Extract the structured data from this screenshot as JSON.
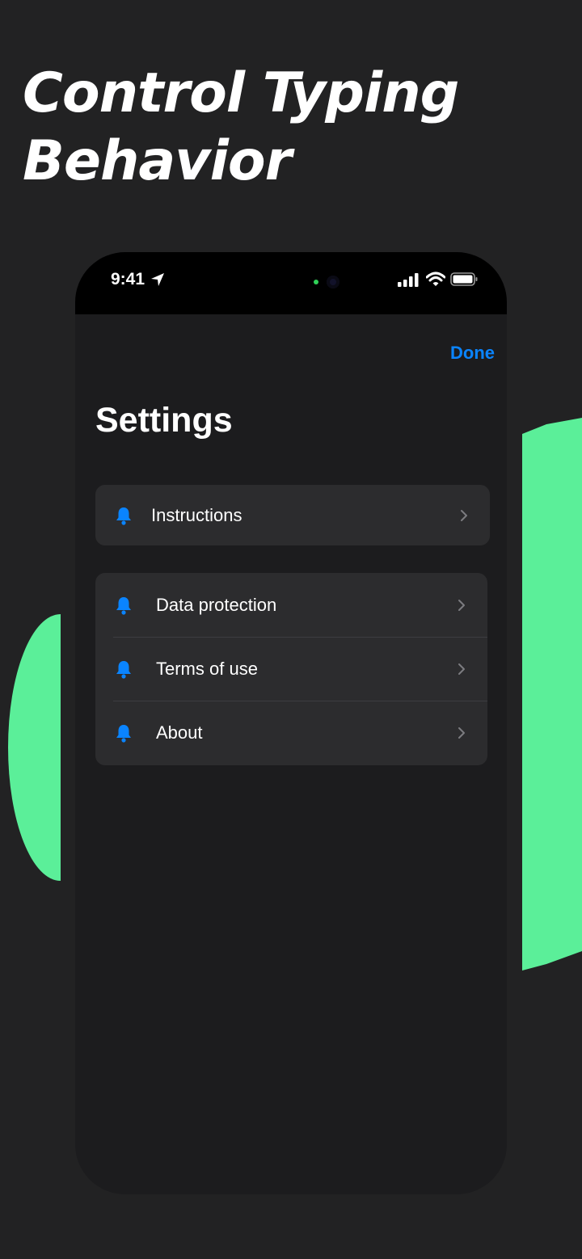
{
  "headline": [
    "Control Typing",
    "Behavior"
  ],
  "status_bar": {
    "time": "9:41",
    "icons": [
      "location-arrow-icon",
      "cellular-signal-icon",
      "wifi-icon",
      "battery-icon"
    ]
  },
  "nav": {
    "done_label": "Done"
  },
  "page_title": "Settings",
  "groups": [
    [
      {
        "label": "Instructions",
        "icon": "bell-icon"
      }
    ],
    [
      {
        "label": "Data protection",
        "icon": "bell-icon"
      },
      {
        "label": "Terms of use",
        "icon": "bell-icon"
      },
      {
        "label": "About",
        "icon": "bell-icon"
      }
    ]
  ],
  "colors": {
    "background": "#222223",
    "accent_green": "#5bef99",
    "link_blue": "#0a84ff",
    "cell": "#2c2c2e",
    "screen": "#1c1c1e"
  }
}
